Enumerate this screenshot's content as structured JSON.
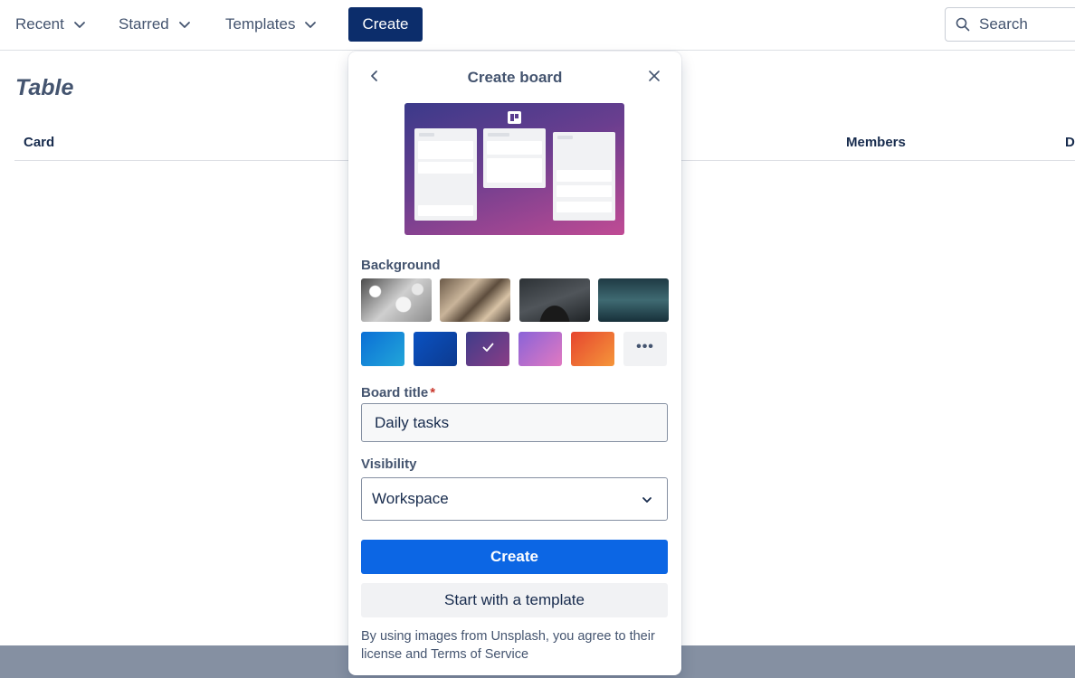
{
  "nav": {
    "recent": "Recent",
    "starred": "Starred",
    "templates": "Templates",
    "create": "Create",
    "search_placeholder": "Search"
  },
  "page": {
    "title": "Table",
    "columns": [
      "Card",
      "Members",
      "D"
    ]
  },
  "popover": {
    "title": "Create board",
    "background_label": "Background",
    "background_photos": [
      "snowy-branches",
      "golden-leaves",
      "starry-night",
      "dark-sea"
    ],
    "background_colors": [
      {
        "name": "blue-light",
        "color": "#0b6fd6"
      },
      {
        "name": "blue-dark",
        "color": "#0a52c2"
      },
      {
        "name": "purple-selected",
        "color": "#5a3d8f",
        "selected": true
      },
      {
        "name": "violet-pink",
        "color": "#a86fd0"
      },
      {
        "name": "orange",
        "color": "#ee6a35"
      }
    ],
    "more_label": "•••",
    "board_title_label": "Board title",
    "required_mark": "*",
    "board_title_value": "Daily tasks",
    "visibility_label": "Visibility",
    "visibility_value": "Workspace",
    "create_button": "Create",
    "template_button": "Start with a template",
    "legal_text": "By using images from Unsplash, you agree to their license and Terms of Service"
  },
  "colors": {
    "primary": "#0c66e4",
    "nav_create": "#0c2d6b",
    "required": "#c9372c"
  }
}
